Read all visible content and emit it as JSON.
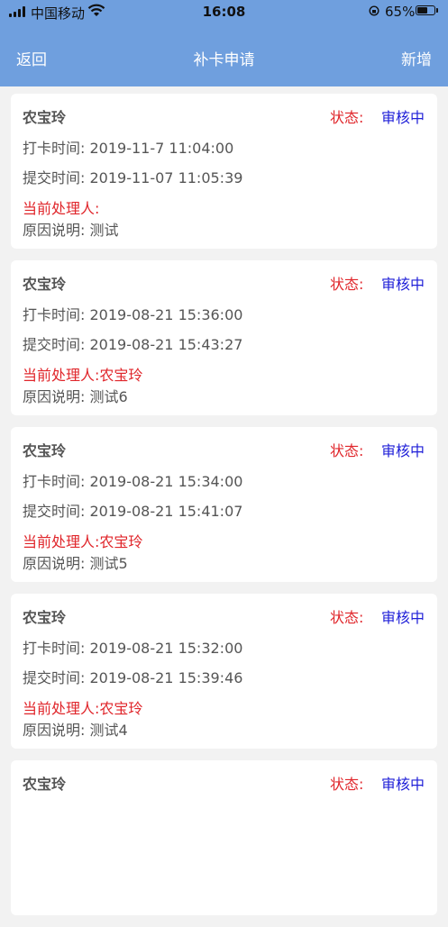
{
  "status_bar": {
    "carrier": "中国移动",
    "time": "16:08",
    "battery_percent": "65%",
    "battery_level": 0.65
  },
  "header": {
    "back_label": "返回",
    "title": "补卡申请",
    "add_label": "新增"
  },
  "labels": {
    "status": "状态:",
    "punch_time": "打卡时间:",
    "submit_time": "提交时间:",
    "handler": "当前处理人:",
    "reason": "原因说明:"
  },
  "records": [
    {
      "name": "农宝玲",
      "status": "审核中",
      "punch_time": "2019-11-7 11:04:00",
      "submit_time": "2019-11-07 11:05:39",
      "handler": "",
      "reason": "测试"
    },
    {
      "name": "农宝玲",
      "status": "审核中",
      "punch_time": "2019-08-21 15:36:00",
      "submit_time": "2019-08-21 15:43:27",
      "handler": "农宝玲",
      "reason": "测试6"
    },
    {
      "name": "农宝玲",
      "status": "审核中",
      "punch_time": "2019-08-21 15:34:00",
      "submit_time": "2019-08-21 15:41:07",
      "handler": "农宝玲",
      "reason": "测试5"
    },
    {
      "name": "农宝玲",
      "status": "审核中",
      "punch_time": "2019-08-21 15:32:00",
      "submit_time": "2019-08-21 15:39:46",
      "handler": "农宝玲",
      "reason": "测试4"
    },
    {
      "name": "农宝玲",
      "status": "审核中"
    }
  ]
}
